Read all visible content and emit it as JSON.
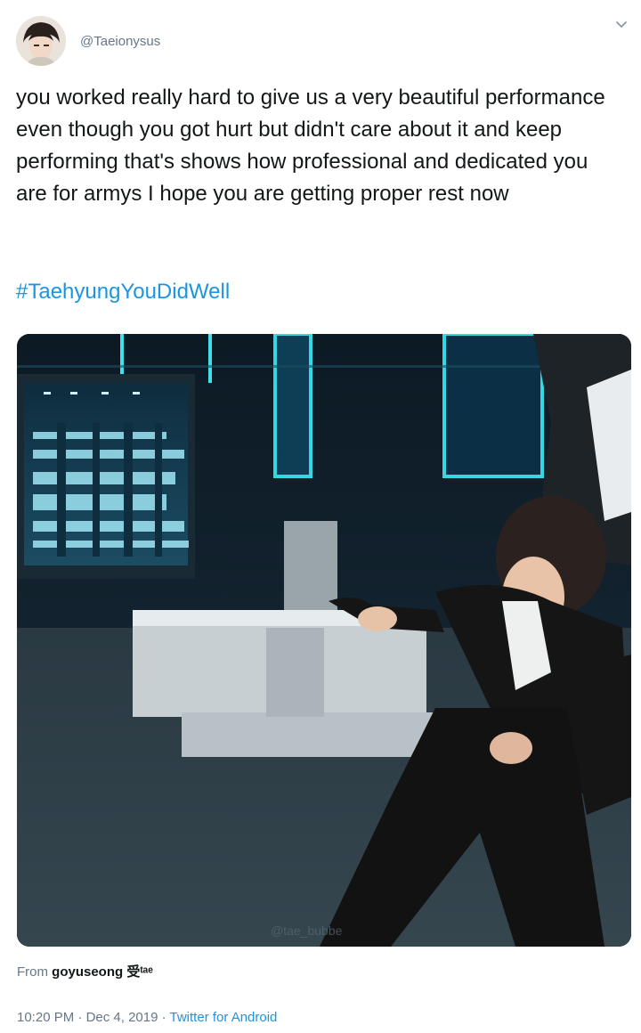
{
  "tweet": {
    "handle": "@Taeionysus",
    "text": "you worked really hard to give us a very beautiful performance even though you got hurt but didn't care about it and keep performing that's shows how professional and dedicated you are for armys I hope you are getting proper rest now",
    "hashtag": "#TaehyungYouDidWell",
    "media_watermark": "@tae_bubbe",
    "from_prefix": "From ",
    "from_source": "goyuseong 受ᵗᵃᵉ",
    "time": "10:20 PM",
    "separator1": " · ",
    "date": "Dec 4, 2019",
    "separator2": " · ",
    "client": "Twitter for Android"
  },
  "icons": {
    "menu": "chevron-down-icon"
  },
  "colors": {
    "text": "#14171a",
    "secondary": "#657786",
    "link": "#1b95e0"
  }
}
